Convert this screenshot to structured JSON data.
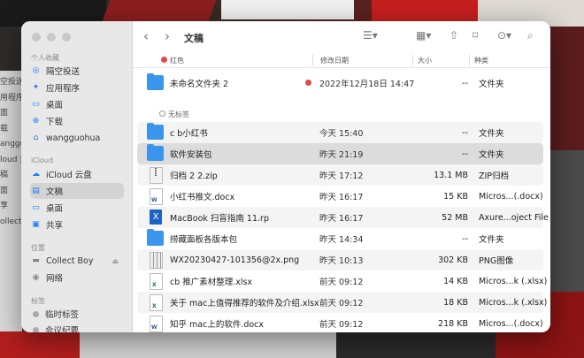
{
  "window": {
    "title": "文稿"
  },
  "background_window_text": [
    "",
    "空投送",
    "用程序",
    "面",
    "载",
    "angguohua",
    "",
    "",
    "",
    "",
    "loud 云盘",
    "稿",
    "面",
    "享",
    "",
    "ollect Boy"
  ],
  "sidebar": {
    "sections": {
      "personal": "个人收藏",
      "icloud": "iCloud",
      "locations": "位置",
      "tags": "标签"
    },
    "items": [
      {
        "label": "隔空投送",
        "icon": "airdrop-icon"
      },
      {
        "label": "应用程序",
        "icon": "applications-icon"
      },
      {
        "label": "桌面",
        "icon": "desktop-icon"
      },
      {
        "label": "下载",
        "icon": "download-icon"
      },
      {
        "label": "wangguohua",
        "icon": "home-icon"
      },
      {
        "label": "iCloud 云盘",
        "icon": "cloud-icon"
      },
      {
        "label": "文稿",
        "icon": "document-icon"
      },
      {
        "label": "桌面",
        "icon": "desktop-icon"
      },
      {
        "label": "共享",
        "icon": "shared-folder-icon"
      },
      {
        "label": "Collect Boy",
        "icon": "disk-icon"
      },
      {
        "label": "网络",
        "icon": "network-icon"
      },
      {
        "label": "临时标签",
        "icon": "tag-dot-icon"
      },
      {
        "label": "会议纪要",
        "icon": "tag-dot-icon"
      }
    ]
  },
  "header": {
    "name": "红色",
    "date": "修改日期",
    "size": "大小",
    "kind": "种类"
  },
  "groups": {
    "red": "红色",
    "untagged": "无标签"
  },
  "files": [
    {
      "name": "未命名文件夹 2",
      "date": "2022年12月18日 14:47",
      "size": "--",
      "kind": "文件夹",
      "icon": "folder-icon"
    },
    {
      "name": "c b小红书",
      "date": "今天 15:40",
      "size": "--",
      "kind": "文件夹",
      "icon": "folder-icon"
    },
    {
      "name": "软件安装包",
      "date": "昨天 21:19",
      "size": "--",
      "kind": "文件夹",
      "icon": "folder-icon"
    },
    {
      "name": "归档 2 2.zip",
      "date": "昨天 17:12",
      "size": "13.1 MB",
      "kind": "ZIP归档",
      "icon": "zip-file-icon"
    },
    {
      "name": "小红书推文.docx",
      "date": "昨天 16:17",
      "size": "15 KB",
      "kind": "Micros...(.docx)",
      "icon": "word-file-icon"
    },
    {
      "name": "MacBook 扫盲指南 11.rp",
      "date": "昨天 16:17",
      "size": "52 MB",
      "kind": "Axure...oject File",
      "icon": "axure-file-icon"
    },
    {
      "name": "捞藏面板各版本包",
      "date": "昨天 14:34",
      "size": "--",
      "kind": "文件夹",
      "icon": "folder-icon"
    },
    {
      "name": "WX20230427-101356@2x.png",
      "date": "昨天 10:13",
      "size": "302 KB",
      "kind": "PNG图像",
      "icon": "image-file-icon"
    },
    {
      "name": "cb 推广素材整理.xlsx",
      "date": "前天 09:12",
      "size": "14 KB",
      "kind": "Micros...k (.xlsx)",
      "icon": "excel-file-icon"
    },
    {
      "name": "关于 mac上值得推荐的软件及介绍.xlsx",
      "date": "前天 09:12",
      "size": "18 KB",
      "kind": "Micros...k (.xlsx)",
      "icon": "excel-file-icon"
    },
    {
      "name": "知乎 mac上的软件.docx",
      "date": "前天 09:12",
      "size": "218 KB",
      "kind": "Micros...(.docx)",
      "icon": "word-file-icon"
    }
  ],
  "colors": {
    "accent": "#1e7cf2",
    "folder": "#3b95ec",
    "tag_red": "#e34a4a"
  }
}
